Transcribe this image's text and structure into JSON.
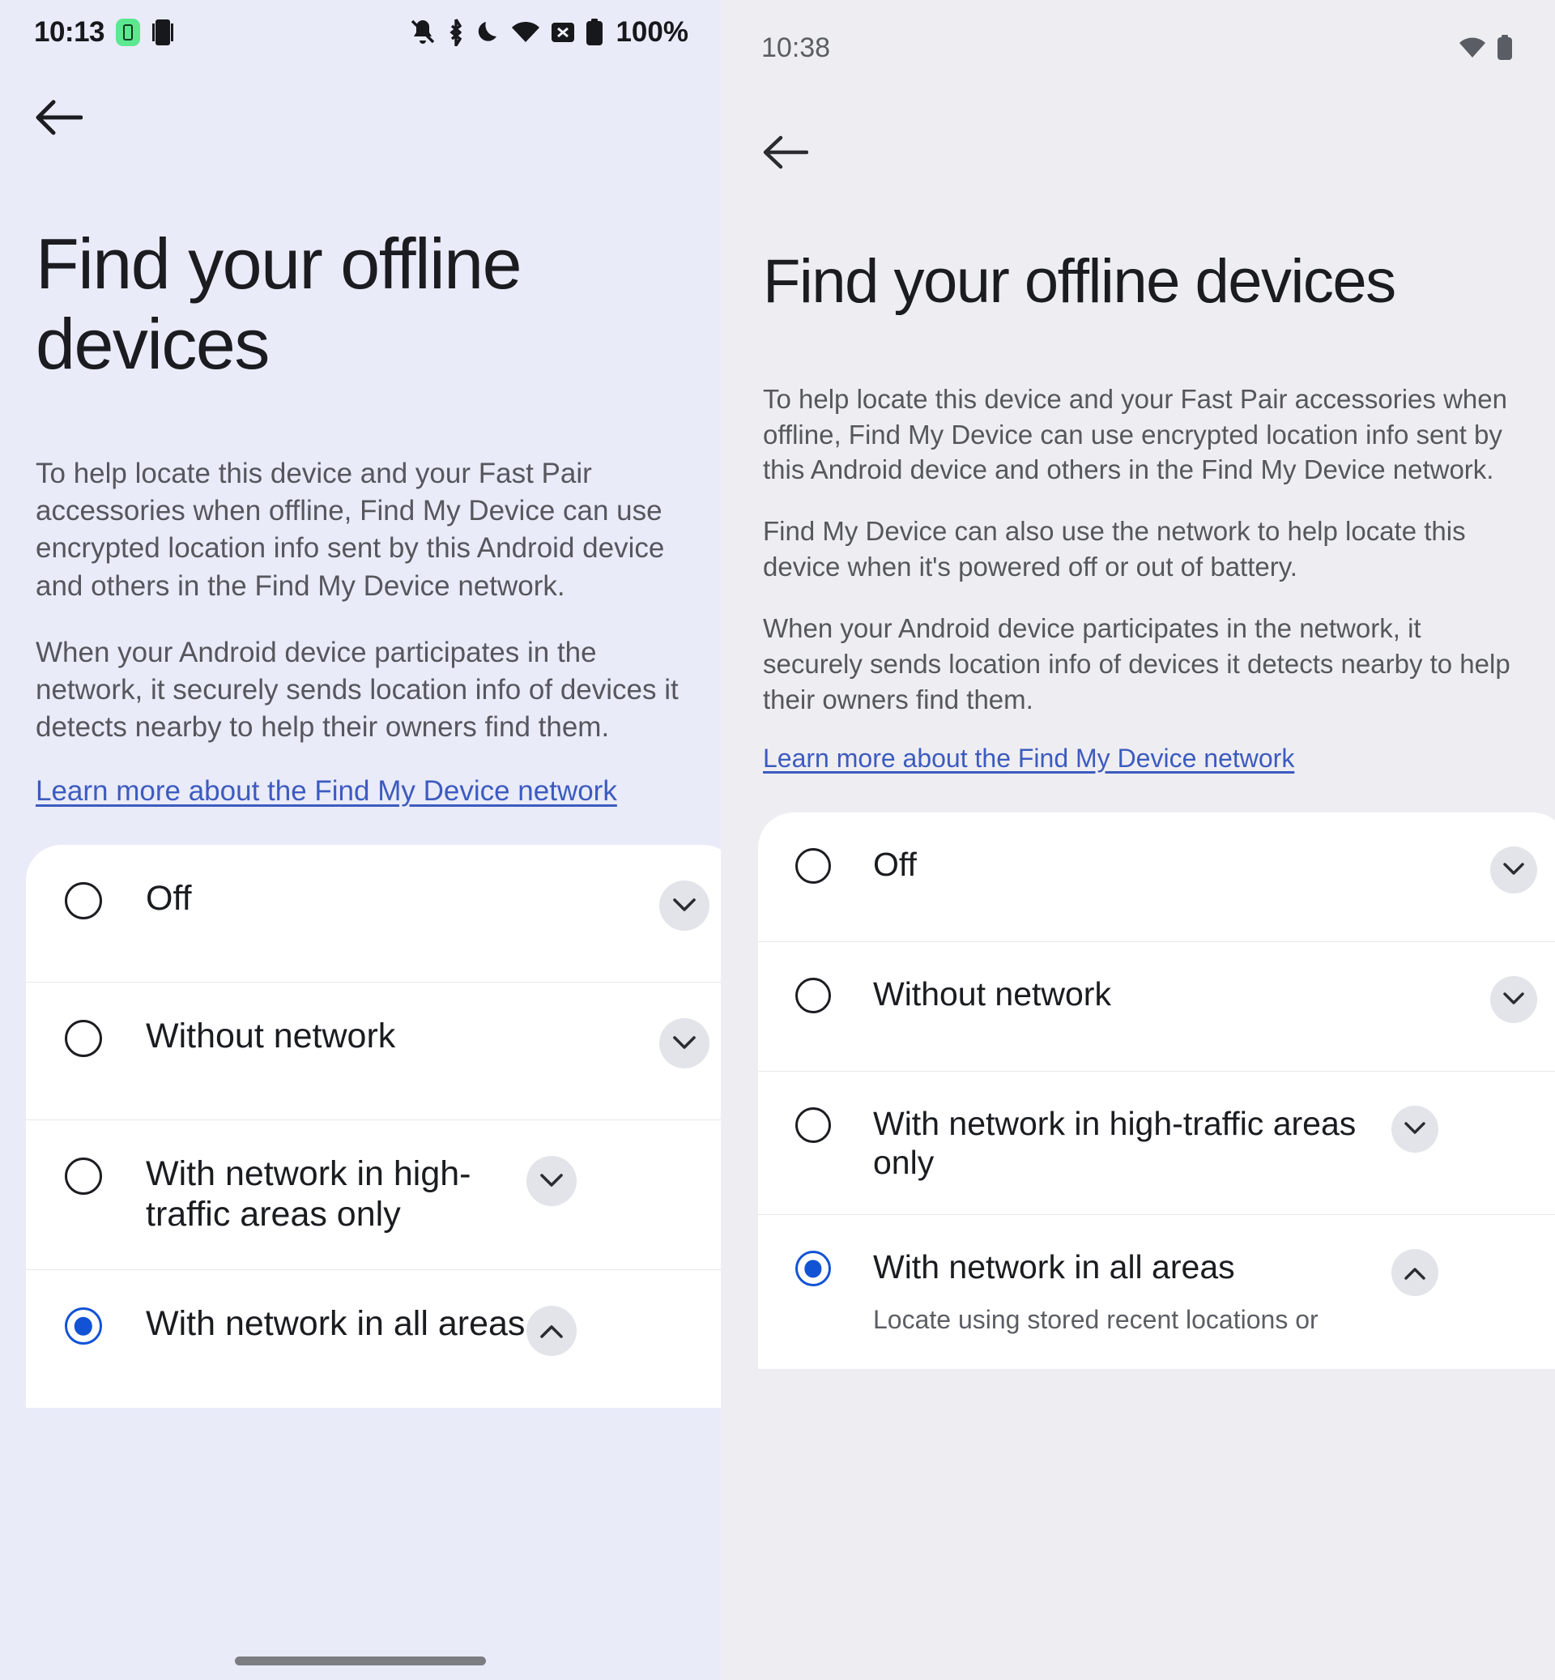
{
  "left_panel": {
    "status_bar": {
      "time": "10:13",
      "battery_percent": "100%",
      "left_icons": [
        "battery-saver-chip-icon",
        "screen-record-icon"
      ],
      "right_icons": [
        "notifications-muted-icon",
        "bluetooth-icon",
        "do-not-disturb-moon-icon",
        "wifi-icon",
        "cast-blocked-icon",
        "battery-full-icon"
      ]
    },
    "back_label": "Back",
    "title": "Find your offline devices",
    "paragraphs": [
      "To help locate this device and your Fast Pair accessories when offline, Find My Device can use encrypted location info sent by this Android device and others in the Find My Device network.",
      "When your Android device participates in the network, it securely sends location info of devices it detects nearby to help their owners find them."
    ],
    "learn_more_link": "Learn more about the Find My Device network",
    "options": [
      {
        "label": "Off",
        "selected": false,
        "chevron": "chevron-down-icon",
        "sub": ""
      },
      {
        "label": "Without network",
        "selected": false,
        "chevron": "chevron-down-icon",
        "sub": ""
      },
      {
        "label": "With network in high-traffic areas only",
        "selected": false,
        "chevron": "chevron-down-icon",
        "sub": ""
      },
      {
        "label": "With network in all areas",
        "selected": true,
        "chevron": "chevron-up-icon",
        "sub": ""
      }
    ]
  },
  "right_panel": {
    "status_bar": {
      "time": "10:38",
      "right_icons": [
        "wifi-icon",
        "battery-full-icon"
      ]
    },
    "back_label": "Back",
    "title": "Find your offline devices",
    "paragraphs": [
      "To help locate this device and your Fast Pair accessories when offline, Find My Device can use encrypted location info sent by this Android device and others in the Find My Device network.",
      "Find My Device can also use the network to help locate this device when it's powered off or out of battery.",
      "When your Android device participates in the network, it securely sends location info of devices it detects nearby to help their owners find them."
    ],
    "learn_more_link": "Learn more about the Find My Device network",
    "options": [
      {
        "label": "Off",
        "selected": false,
        "chevron": "chevron-down-icon",
        "sub": ""
      },
      {
        "label": "Without network",
        "selected": false,
        "chevron": "chevron-down-icon",
        "sub": ""
      },
      {
        "label": "With network in high-traffic areas only",
        "selected": false,
        "chevron": "chevron-down-icon",
        "sub": ""
      },
      {
        "label": "With network in all areas",
        "selected": true,
        "chevron": "chevron-up-icon",
        "sub": "Locate using stored recent locations or"
      }
    ]
  },
  "colors": {
    "left_background": "#e9ebf9",
    "right_background": "#eeeef2",
    "card_background": "#ffffff",
    "accent_selected": "#1253d6",
    "link": "#3d5bbf",
    "title_text": "#1a1c20",
    "body_text": "#55575d",
    "chevron_circle": "#e3e4e9",
    "battery_chip_green": "#5ce88f"
  }
}
